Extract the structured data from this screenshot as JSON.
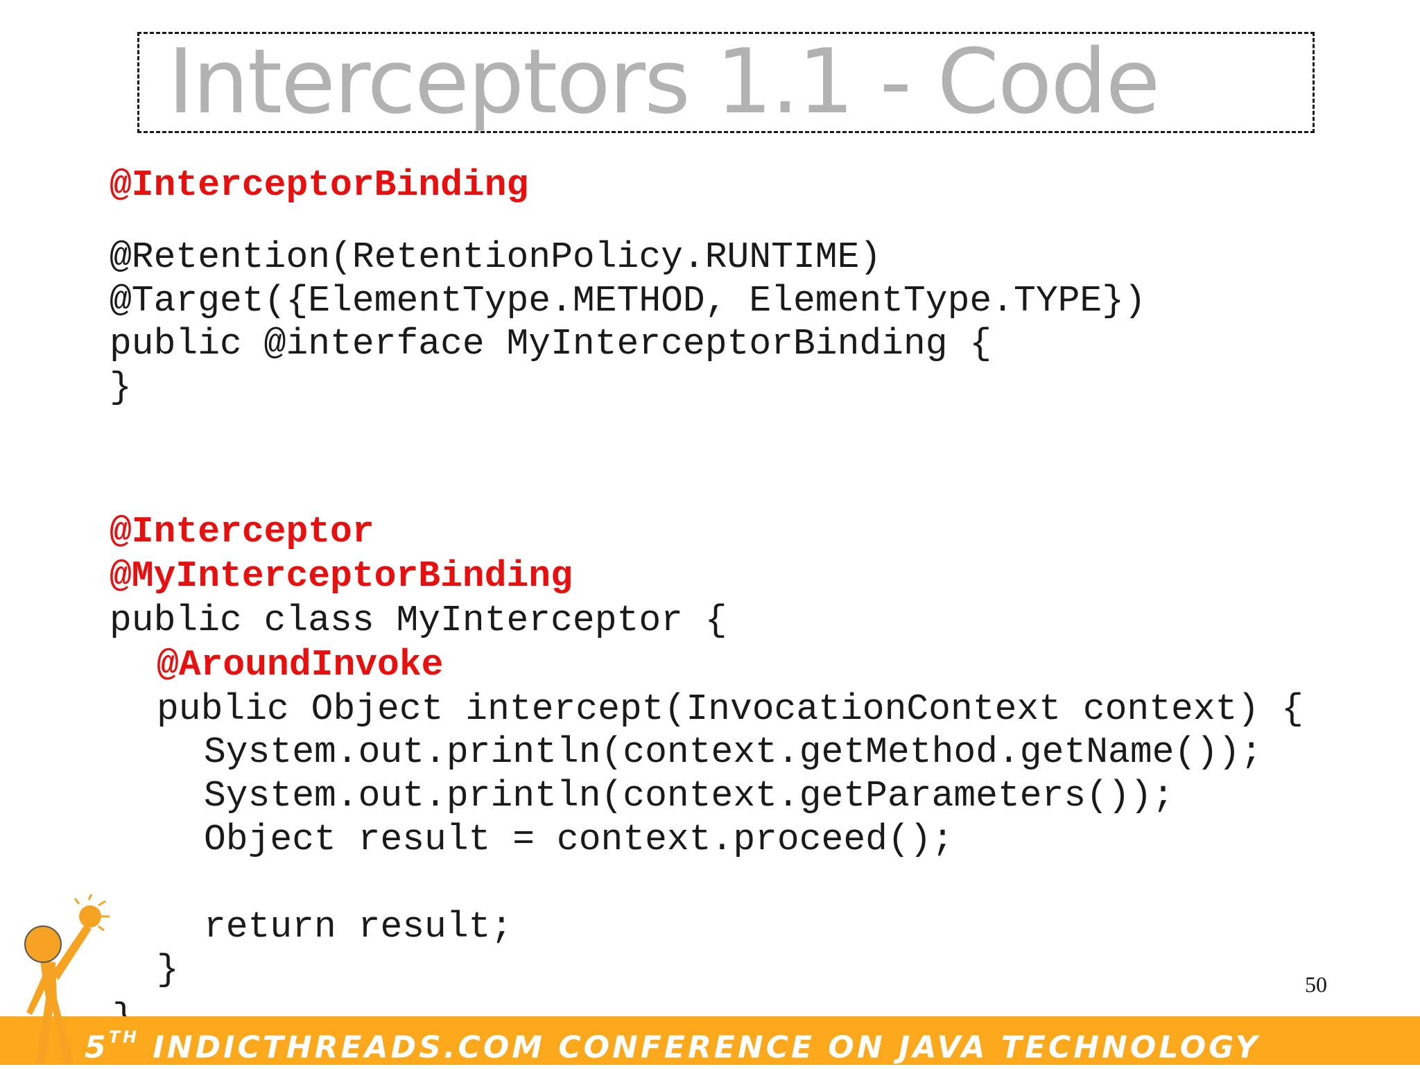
{
  "slide": {
    "title": "Interceptors 1.1 - Code",
    "page_number": "50"
  },
  "code_block_1": {
    "annotation": "@InterceptorBinding",
    "lines": [
      "@Retention(RetentionPolicy.RUNTIME)",
      "@Target({ElementType.METHOD, ElementType.TYPE})",
      "public @interface MyInterceptorBinding {",
      "}"
    ]
  },
  "code_block_2": {
    "annotation_1": "@Interceptor",
    "annotation_2": "@MyInterceptorBinding",
    "class_decl": "public class MyInterceptor {",
    "method_annotation": "@AroundInvoke",
    "method_decl": "public Object intercept(InvocationContext context) {",
    "body": [
      "System.out.println(context.getMethod.getName());",
      "System.out.println(context.getParameters());",
      "Object result = context.proceed();",
      "return result;"
    ],
    "method_close": "}",
    "class_close": "}"
  },
  "footer": {
    "ordinal_number": "5",
    "ordinal_suffix": "TH",
    "text": "INDICTHREADS.COM CONFERENCE ON JAVA TECHNOLOGY"
  },
  "colors": {
    "annotation": "#e8100f",
    "footer_bar": "#fba81d",
    "title": "#b2b2b2"
  },
  "icons": {
    "mascot": "juggler-mascot-icon"
  }
}
